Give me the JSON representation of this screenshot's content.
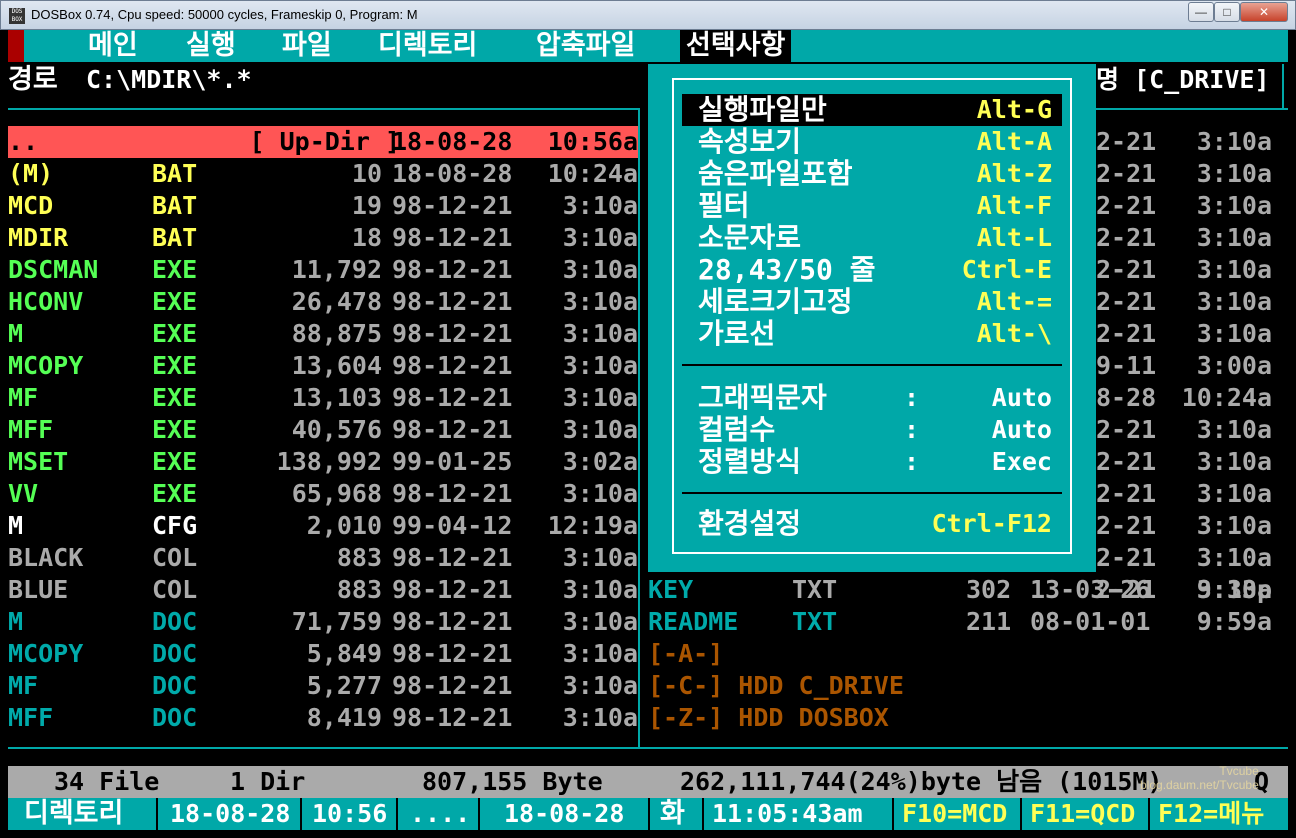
{
  "window": {
    "title": "DOSBox 0.74, Cpu speed:     50000 cycles, Frameskip  0, Program:         M",
    "icon": "dosbox-icon",
    "min": "—",
    "max": "□",
    "close": "✕"
  },
  "menu": {
    "items": [
      "메인",
      "실행",
      "파일",
      "디렉토리",
      "압축파일",
      "선택사항"
    ]
  },
  "path": {
    "label": "경로",
    "value": "C:\\MDIR\\*.*"
  },
  "right_header": "명 [C_DRIVE]",
  "updir": {
    "name": "..",
    "ext": "",
    "size": "[ Up-Dir ]",
    "date": "18-08-28",
    "time": "10:56a"
  },
  "files": [
    {
      "name": "(M)",
      "ext": "BAT",
      "size": "10",
      "date": "18-08-28",
      "time": "10:24a",
      "color": "#ffff55"
    },
    {
      "name": "MCD",
      "ext": "BAT",
      "size": "19",
      "date": "98-12-21",
      "time": "3:10a",
      "color": "#ffff55"
    },
    {
      "name": "MDIR",
      "ext": "BAT",
      "size": "18",
      "date": "98-12-21",
      "time": "3:10a",
      "color": "#ffff55"
    },
    {
      "name": "DSCMAN",
      "ext": "EXE",
      "size": "11,792",
      "date": "98-12-21",
      "time": "3:10a",
      "color": "#55ff55"
    },
    {
      "name": "HCONV",
      "ext": "EXE",
      "size": "26,478",
      "date": "98-12-21",
      "time": "3:10a",
      "color": "#55ff55"
    },
    {
      "name": "M",
      "ext": "EXE",
      "size": "88,875",
      "date": "98-12-21",
      "time": "3:10a",
      "color": "#55ff55"
    },
    {
      "name": "MCOPY",
      "ext": "EXE",
      "size": "13,604",
      "date": "98-12-21",
      "time": "3:10a",
      "color": "#55ff55"
    },
    {
      "name": "MF",
      "ext": "EXE",
      "size": "13,103",
      "date": "98-12-21",
      "time": "3:10a",
      "color": "#55ff55"
    },
    {
      "name": "MFF",
      "ext": "EXE",
      "size": "40,576",
      "date": "98-12-21",
      "time": "3:10a",
      "color": "#55ff55"
    },
    {
      "name": "MSET",
      "ext": "EXE",
      "size": "138,992",
      "date": "99-01-25",
      "time": "3:02a",
      "color": "#55ff55"
    },
    {
      "name": "VV",
      "ext": "EXE",
      "size": "65,968",
      "date": "98-12-21",
      "time": "3:10a",
      "color": "#55ff55"
    },
    {
      "name": "M",
      "ext": "CFG",
      "size": "2,010",
      "date": "99-04-12",
      "time": "12:19a",
      "color": "#ffffff"
    },
    {
      "name": "BLACK",
      "ext": "COL",
      "size": "883",
      "date": "98-12-21",
      "time": "3:10a",
      "color": "#aaaaaa"
    },
    {
      "name": "BLUE",
      "ext": "COL",
      "size": "883",
      "date": "98-12-21",
      "time": "3:10a",
      "color": "#aaaaaa"
    },
    {
      "name": "M",
      "ext": "DOC",
      "size": "71,759",
      "date": "98-12-21",
      "time": "3:10a",
      "color": "#00aaaa"
    },
    {
      "name": "MCOPY",
      "ext": "DOC",
      "size": "5,849",
      "date": "98-12-21",
      "time": "3:10a",
      "color": "#00aaaa"
    },
    {
      "name": "MF",
      "ext": "DOC",
      "size": "5,277",
      "date": "98-12-21",
      "time": "3:10a",
      "color": "#00aaaa"
    },
    {
      "name": "MFF",
      "ext": "DOC",
      "size": "8,419",
      "date": "98-12-21",
      "time": "3:10a",
      "color": "#00aaaa"
    }
  ],
  "right_files": [
    {
      "date": "2-21",
      "time": "3:10a"
    },
    {
      "date": "2-21",
      "time": "3:10a"
    },
    {
      "date": "2-21",
      "time": "3:10a"
    },
    {
      "date": "2-21",
      "time": "3:10a"
    },
    {
      "date": "2-21",
      "time": "3:10a"
    },
    {
      "date": "2-21",
      "time": "3:10a"
    },
    {
      "date": "2-21",
      "time": "3:10a"
    },
    {
      "date": "9-11",
      "time": "3:00a"
    },
    {
      "date": "8-28",
      "time": "10:24a"
    },
    {
      "date": "2-21",
      "time": "3:10a"
    },
    {
      "date": "2-21",
      "time": "3:10a"
    },
    {
      "date": "2-21",
      "time": "3:10a"
    },
    {
      "date": "2-21",
      "time": "3:10a"
    },
    {
      "date": "2-21",
      "time": "3:10a"
    },
    {
      "date": "2-21",
      "time": "3:10a"
    }
  ],
  "right_bottom": [
    {
      "name": "KEY",
      "ext": "TXT",
      "size": "302",
      "date": "13-03-26",
      "time": "9:33p",
      "color": "#00aaaa",
      "extcolor": "#aaaaaa"
    },
    {
      "name": "README",
      "ext": "TXT",
      "size": "211",
      "date": "08-01-01",
      "time": "9:59a",
      "color": "#00aaaa",
      "extcolor": "#00aaaa"
    }
  ],
  "drives": [
    "[-A-]",
    "[-C-] HDD C_DRIVE",
    "[-Z-] HDD DOSBOX"
  ],
  "popup": {
    "items": [
      {
        "label": "실행파일만",
        "key": "Alt-G",
        "selected": true
      },
      {
        "label": "속성보기",
        "key": "Alt-A"
      },
      {
        "label": "숨은파일포함",
        "key": "Alt-Z"
      },
      {
        "label": "필터",
        "key": "Alt-F"
      },
      {
        "label": "소문자로",
        "key": "Alt-L"
      },
      {
        "label": "28,43/50 줄",
        "key": "Ctrl-E"
      },
      {
        "label": "세로크기고정",
        "key": "Alt-="
      },
      {
        "label": "가로선",
        "key": "Alt-\\"
      }
    ],
    "options": [
      {
        "label": "그래픽문자",
        "sep": ":",
        "value": "Auto"
      },
      {
        "label": "컬럼수",
        "sep": ":",
        "value": "Auto"
      },
      {
        "label": "정렬방식",
        "sep": ":",
        "value": "Exec"
      }
    ],
    "settings": {
      "label": "환경설정",
      "key": "Ctrl-F12"
    }
  },
  "status": {
    "files": "34 File",
    "dirs": "1 Dir",
    "bytes": "807,155 Byte",
    "free": "262,111,744(24%)byte 남음 (1015M)",
    "q": "Q"
  },
  "bottom": {
    "label": "디렉토리",
    "date": "18-08-28",
    "time": "10:56",
    "dots": "....",
    "date2": "18-08-28",
    "day": "화",
    "clock": "11:05:43am",
    "f10": "F10=MCD",
    "f11": "F11=QCD",
    "f12": "F12=메뉴"
  },
  "watermark": {
    "line1": "Tvcube",
    "line2": "blog.daum.net/Tvcube"
  }
}
